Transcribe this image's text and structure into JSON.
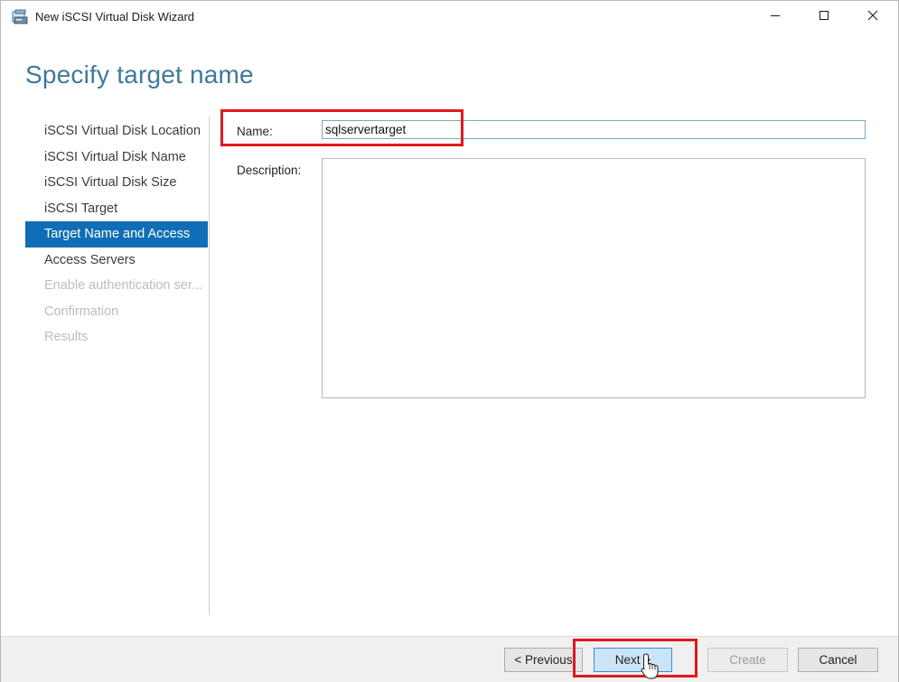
{
  "window": {
    "title": "New iSCSI Virtual Disk Wizard",
    "icons": {
      "app": "disk-wizard-icon",
      "minimize": "minimize-icon",
      "maximize": "maximize-icon",
      "close": "close-icon"
    }
  },
  "page": {
    "title": "Specify target name"
  },
  "nav": {
    "items": [
      {
        "label": "iSCSI Virtual Disk Location",
        "state": "normal"
      },
      {
        "label": "iSCSI Virtual Disk Name",
        "state": "normal"
      },
      {
        "label": "iSCSI Virtual Disk Size",
        "state": "normal"
      },
      {
        "label": "iSCSI Target",
        "state": "normal"
      },
      {
        "label": "Target Name and Access",
        "state": "active"
      },
      {
        "label": "Access Servers",
        "state": "normal"
      },
      {
        "label": "Enable authentication ser...",
        "state": "disabled"
      },
      {
        "label": "Confirmation",
        "state": "disabled"
      },
      {
        "label": "Results",
        "state": "disabled"
      }
    ]
  },
  "form": {
    "name_label": "Name:",
    "name_value": "sqlservertarget",
    "description_label": "Description:",
    "description_value": ""
  },
  "buttons": {
    "previous": "< Previous",
    "next": "Next >",
    "create": "Create",
    "cancel": "Cancel"
  },
  "colors": {
    "accent": "#0f6eb5",
    "title": "#3e7a99",
    "highlight": "#e0191f"
  }
}
